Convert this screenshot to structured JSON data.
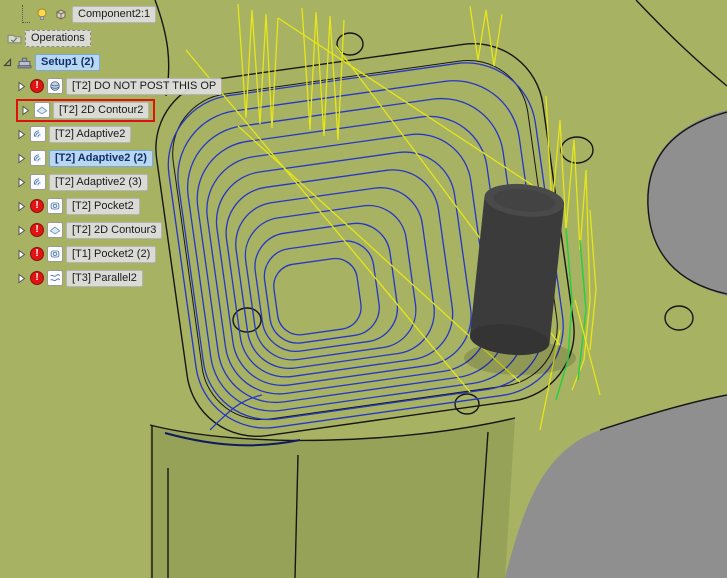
{
  "browser": {
    "component_label": "Component2:1",
    "operations_folder_label": "Operations",
    "setup_label": "Setup1 (2)",
    "operations": [
      {
        "label": "[T2] DO NOT POST THIS OP",
        "icon": "3d-adaptive-icon",
        "error": true,
        "state": "normal"
      },
      {
        "label": "[T2] 2D Contour2",
        "icon": "2d-contour-icon",
        "error": false,
        "state": "red-outline"
      },
      {
        "label": "[T2] Adaptive2",
        "icon": "adaptive-icon",
        "error": false,
        "state": "normal"
      },
      {
        "label": "[T2] Adaptive2 (2)",
        "icon": "adaptive-icon",
        "error": false,
        "state": "selected"
      },
      {
        "label": "[T2] Adaptive2 (3)",
        "icon": "adaptive-icon",
        "error": false,
        "state": "normal"
      },
      {
        "label": "[T2] Pocket2",
        "icon": "pocket-icon",
        "error": true,
        "state": "normal"
      },
      {
        "label": "[T2] 2D Contour3",
        "icon": "2d-contour-icon",
        "error": true,
        "state": "normal"
      },
      {
        "label": "[T1] Pocket2 (2)",
        "icon": "pocket-icon",
        "error": true,
        "state": "normal"
      },
      {
        "label": "[T3] Parallel2",
        "icon": "parallel-icon",
        "error": true,
        "state": "normal"
      }
    ]
  },
  "viewport": {
    "colors": {
      "part_green": "#a7b263",
      "part_side_green": "#96a257",
      "background_gray": "#8f8f8f",
      "toolpath_blue": "#2636c8",
      "rapid_yellow": "#e6e61a",
      "selected_geometry_green": "#2ecc40",
      "tool_dark_gray": "#3b3b3b",
      "edge_black": "#161616",
      "selection_highlight_blue": "#b9d7f1",
      "error_red": "#e01414",
      "outline_red": "#e01010"
    }
  }
}
